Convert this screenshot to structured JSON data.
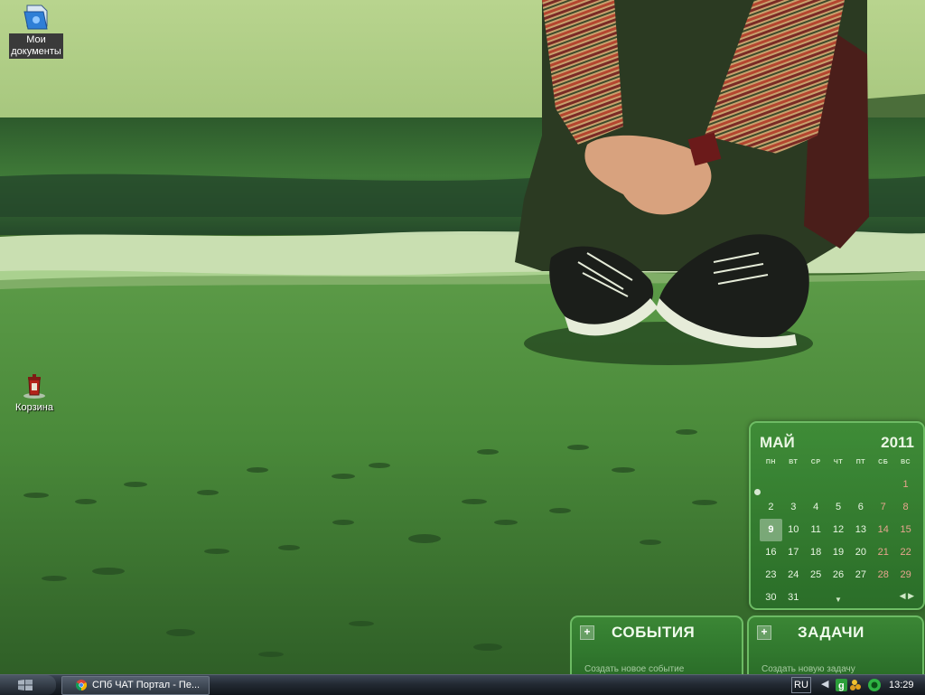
{
  "desktop": {
    "icons": [
      {
        "label": "Мои\nдокументы",
        "icon": "my-documents-icon"
      },
      {
        "label": "Корзина",
        "icon": "recycle-bin-icon"
      }
    ]
  },
  "calendar": {
    "month": "МАЙ",
    "year": "2011",
    "weekdays": [
      "ПН",
      "ВТ",
      "СР",
      "ЧТ",
      "ПТ",
      "СБ",
      "ВС"
    ],
    "weeks": [
      [
        "",
        "",
        "",
        "",
        "",
        "",
        "1"
      ],
      [
        "2",
        "3",
        "4",
        "5",
        "6",
        "7",
        "8"
      ],
      [
        "9",
        "10",
        "11",
        "12",
        "13",
        "14",
        "15"
      ],
      [
        "16",
        "17",
        "18",
        "19",
        "20",
        "21",
        "22"
      ],
      [
        "23",
        "24",
        "25",
        "26",
        "27",
        "28",
        "29"
      ],
      [
        "30",
        "31",
        "",
        "",
        "",
        "",
        ""
      ]
    ],
    "today": "9",
    "weekend_color": "#e8a58f"
  },
  "events": {
    "title": "СОБЫТИЯ",
    "hint": "Создать новое событие"
  },
  "tasks": {
    "title": "ЗАДАЧИ",
    "hint": "Создать новую задачу"
  },
  "taskbar": {
    "window_title": "СПб ЧАТ Портал - Пе...",
    "language": "RU",
    "clock": "13:29"
  }
}
